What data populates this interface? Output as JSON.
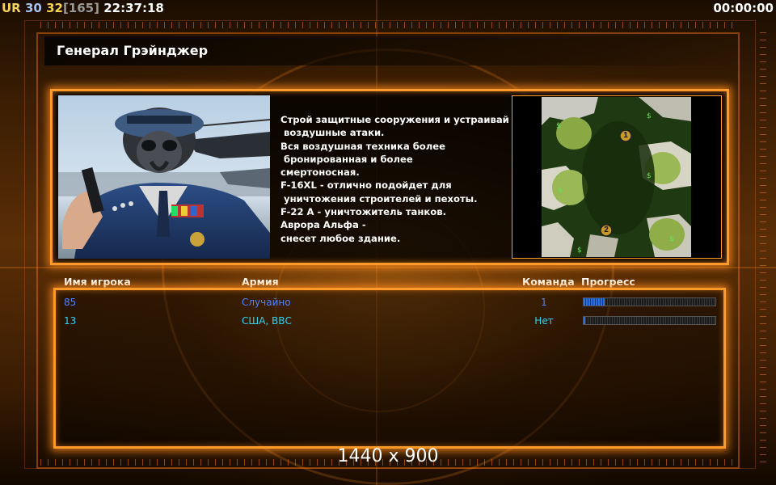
{
  "hud": {
    "ur_label": "UR",
    "value_a": "30",
    "value_b": "32",
    "value_c": "[165]",
    "clock": "22:37:18",
    "timer": "00:00:00"
  },
  "general": {
    "title": "Генерал Грэйнджер",
    "description_lines": [
      "Строй защитные сооружения и устраивай",
      " воздушные атаки.",
      "Вся воздушная техника более",
      " бронированная и более",
      "смертоносная.",
      "F-16XL - отлично подойдет для",
      " уничтожения строителей и пехоты.",
      "F-22 A - уничтожитель танков.",
      "Аврора Альфа -",
      "снесет любое здание."
    ]
  },
  "map": {
    "start_positions": [
      "1",
      "2"
    ]
  },
  "players_table": {
    "headers": {
      "name": "Имя игрока",
      "army": "Армия",
      "team": "Команда",
      "progress": "Прогресс"
    },
    "rows": [
      {
        "name": "85",
        "army": "Случайно",
        "team": "1",
        "progress": 0.16,
        "color": "#4f82ff"
      },
      {
        "name": "13",
        "army": "США, ВВС",
        "team": "Нет",
        "progress": 0.01,
        "color": "#34d0f0"
      }
    ]
  },
  "resolution_text": "1440 x 900",
  "colors": {
    "accent": "#ff9a2a",
    "progress_fill": "#2a6ee0"
  }
}
